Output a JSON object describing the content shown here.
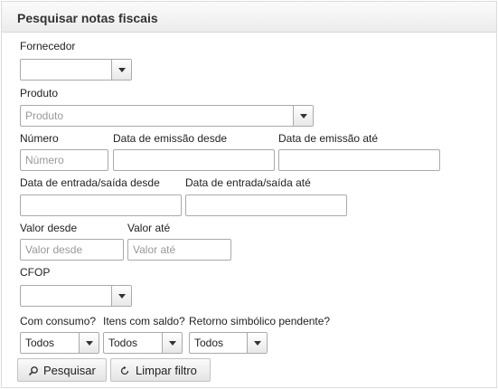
{
  "panel": {
    "title": "Pesquisar notas fiscais"
  },
  "labels": {
    "fornecedor": "Fornecedor",
    "produto": "Produto",
    "numero": "Número",
    "emissao_desde": "Data de emissão desde",
    "emissao_ate": "Data de emissão até",
    "entrada_desde": "Data de entrada/saída desde",
    "entrada_ate": "Data de entrada/saída até",
    "valor_desde": "Valor desde",
    "valor_ate": "Valor até",
    "cfop": "CFOP",
    "com_consumo": "Com consumo?",
    "itens_saldo": "Itens com saldo?",
    "retorno_simbolico": "Retorno simbólico pendente?"
  },
  "fields": {
    "fornecedor": {
      "value": ""
    },
    "produto": {
      "placeholder": "Produto"
    },
    "numero": {
      "placeholder": "Número"
    },
    "emissao_desde": {
      "value": ""
    },
    "emissao_ate": {
      "value": ""
    },
    "entrada_desde": {
      "value": ""
    },
    "entrada_ate": {
      "value": ""
    },
    "valor_desde": {
      "placeholder": "Valor desde"
    },
    "valor_ate": {
      "placeholder": "Valor até"
    },
    "cfop": {
      "value": ""
    },
    "com_consumo": {
      "value": "Todos"
    },
    "itens_saldo": {
      "value": "Todos"
    },
    "retorno_simbolico": {
      "value": "Todos"
    }
  },
  "buttons": {
    "pesquisar": {
      "label": "Pesquisar",
      "icon": "search-icon"
    },
    "limpar": {
      "label": "Limpar filtro",
      "icon": "refresh-icon"
    }
  }
}
